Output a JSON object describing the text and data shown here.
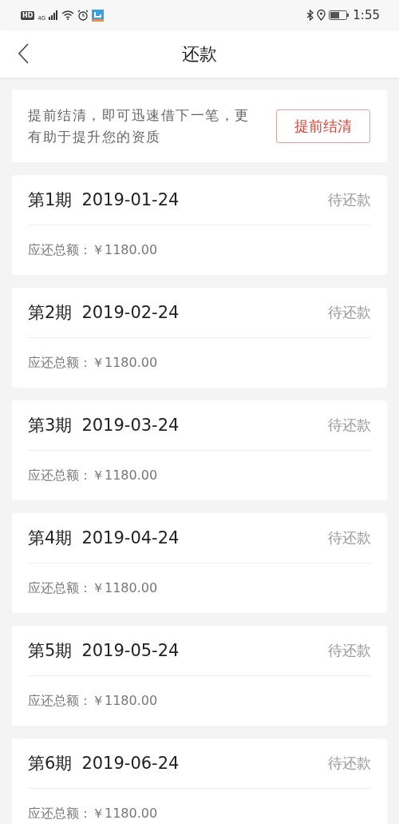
{
  "status_bar": {
    "hd_badge": "HD",
    "network_type": "4G",
    "time": "1:55"
  },
  "nav": {
    "title": "还款"
  },
  "notice": {
    "text": "提前结清，即可迅速借下一笔，更有助于提升您的资质",
    "button": "提前结清"
  },
  "installments": [
    {
      "period": "第1期",
      "date": "2019-01-24",
      "status": "待还款",
      "amount_label": "应还总额：",
      "amount": "￥1180.00"
    },
    {
      "period": "第2期",
      "date": "2019-02-24",
      "status": "待还款",
      "amount_label": "应还总额：",
      "amount": "￥1180.00"
    },
    {
      "period": "第3期",
      "date": "2019-03-24",
      "status": "待还款",
      "amount_label": "应还总额：",
      "amount": "￥1180.00"
    },
    {
      "period": "第4期",
      "date": "2019-04-24",
      "status": "待还款",
      "amount_label": "应还总额：",
      "amount": "￥1180.00"
    },
    {
      "period": "第5期",
      "date": "2019-05-24",
      "status": "待还款",
      "amount_label": "应还总额：",
      "amount": "￥1180.00"
    },
    {
      "period": "第6期",
      "date": "2019-06-24",
      "status": "待还款",
      "amount_label": "应还总额：",
      "amount": "￥1180.00"
    }
  ]
}
